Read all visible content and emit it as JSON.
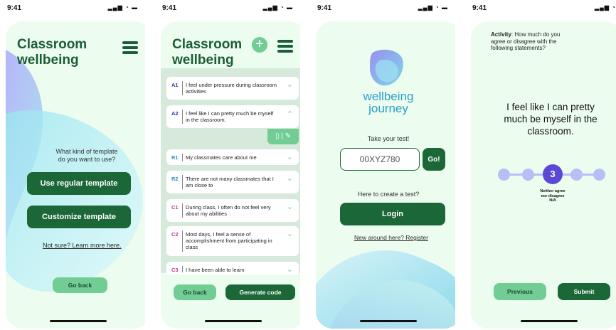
{
  "screens": [
    {
      "time": "9:41",
      "title_line1": "Classroom",
      "title_line2": "wellbeing",
      "question_line1": "What kind of template",
      "question_line2": "do you want to use?",
      "regular_btn": "Use regular template",
      "customize_btn": "Customize template",
      "learn_more": "Not sure? Learn more here.",
      "back_btn": "Go back"
    },
    {
      "time": "9:41",
      "title_line1": "Classroom",
      "title_line2": "wellbeing",
      "items": [
        {
          "code": "A1",
          "text": "I feel under pressure during classroom activities",
          "expanded": false,
          "color": "#1f3ea8"
        },
        {
          "code": "A2",
          "text": "I feel like I can pretty much be myself in the classroom.",
          "expanded": true,
          "color": "#1f3ea8"
        },
        {
          "code": "R1",
          "text": "My classmates care about me",
          "expanded": false,
          "color": "#2c8fc7"
        },
        {
          "code": "R2",
          "text": "There are not many classmates that I am close to",
          "expanded": false,
          "color": "#2c8fc7"
        },
        {
          "code": "C1",
          "text": "During class, I often do not feel very about my abilities",
          "expanded": false,
          "color": "#c23a9a"
        },
        {
          "code": "C2",
          "text": "Most days, I feel a sense of accomplishment from participating in class",
          "expanded": false,
          "color": "#c23a9a"
        },
        {
          "code": "C3",
          "text": "I have been able to learn",
          "expanded": false,
          "color": "#c23a9a"
        }
      ],
      "back_btn": "Go back",
      "generate_btn": "Generate code"
    },
    {
      "time": "9:41",
      "logo_line1": "wellbeing",
      "logo_line2": "journey",
      "take_test": "Take your test!",
      "code_value": "00XYZ780",
      "go_btn": "Go!",
      "create_prompt": "Here to create a test?",
      "login_btn": "Login",
      "register_link": "New around here? Register"
    },
    {
      "time": "9:41",
      "activity_label": "Activity",
      "activity_text": ": How much do you agree or disagree with the following statements?",
      "statement": "I feel like I can pretty much be myself in the classroom.",
      "current_step": "3",
      "step_label_line1": "Neither agree",
      "step_label_line2": "nor disagree",
      "step_label_line3": "N/A",
      "previous_btn": "Previous",
      "submit_btn": "Submit"
    }
  ],
  "colors": {
    "dark_green": "#1b6737",
    "light_green": "#72cd95",
    "card_bg": "#ecfcef",
    "step_dot": "#b8bff6",
    "step_active": "#5b49d6"
  }
}
